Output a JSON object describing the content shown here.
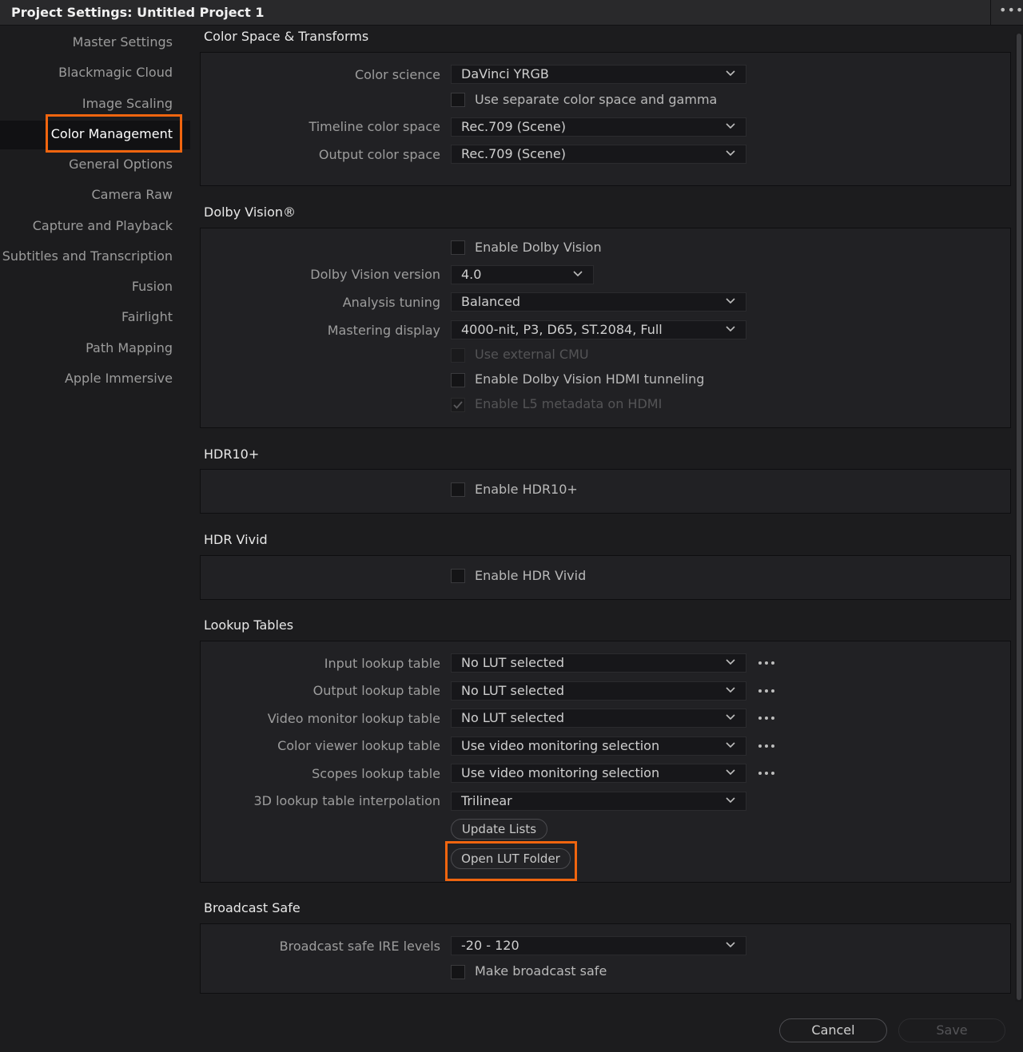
{
  "window": {
    "title": "Project Settings:  Untitled Project 1",
    "more_icon": "more-horizontal-icon"
  },
  "sidebar": {
    "items": [
      {
        "label": "Master Settings"
      },
      {
        "label": "Blackmagic Cloud"
      },
      {
        "label": "Image Scaling"
      },
      {
        "label": "Color Management",
        "active": true
      },
      {
        "label": "General Options"
      },
      {
        "label": "Camera Raw"
      },
      {
        "label": "Capture and Playback"
      },
      {
        "label": "Subtitles and Transcription"
      },
      {
        "label": "Fusion"
      },
      {
        "label": "Fairlight"
      },
      {
        "label": "Path Mapping"
      },
      {
        "label": "Apple Immersive"
      }
    ]
  },
  "color_space": {
    "title": "Color Space & Transforms",
    "color_science_label": "Color science",
    "color_science_value": "DaVinci YRGB",
    "separate_gamma_label": "Use separate color space and gamma",
    "timeline_label": "Timeline color space",
    "timeline_value": "Rec.709 (Scene)",
    "output_label": "Output color space",
    "output_value": "Rec.709 (Scene)"
  },
  "dolby": {
    "title": "Dolby Vision®",
    "enable_label": "Enable Dolby Vision",
    "version_label": "Dolby Vision version",
    "version_value": "4.0",
    "analysis_label": "Analysis tuning",
    "analysis_value": "Balanced",
    "mastering_label": "Mastering display",
    "mastering_value": "4000-nit, P3, D65, ST.2084, Full",
    "external_cmu_label": "Use external CMU",
    "hdmi_tunneling_label": "Enable Dolby Vision HDMI tunneling",
    "l5_label": "Enable L5 metadata on HDMI"
  },
  "hdr10": {
    "title": "HDR10+",
    "enable_label": "Enable HDR10+"
  },
  "hdr_vivid": {
    "title": "HDR Vivid",
    "enable_label": "Enable HDR Vivid"
  },
  "luts": {
    "title": "Lookup Tables",
    "input_label": "Input lookup table",
    "input_value": "No LUT selected",
    "output_label": "Output lookup table",
    "output_value": "No LUT selected",
    "video_monitor_label": "Video monitor lookup table",
    "video_monitor_value": "No LUT selected",
    "color_viewer_label": "Color viewer lookup table",
    "color_viewer_value": "Use video monitoring selection",
    "scopes_label": "Scopes lookup table",
    "scopes_value": "Use video monitoring selection",
    "interp_label": "3D lookup table interpolation",
    "interp_value": "Trilinear",
    "update_button": "Update Lists",
    "open_folder_button": "Open LUT Folder"
  },
  "broadcast": {
    "title": "Broadcast Safe",
    "ire_label": "Broadcast safe IRE levels",
    "ire_value": "-20 - 120",
    "make_safe_label": "Make broadcast safe"
  },
  "footer": {
    "cancel": "Cancel",
    "save": "Save"
  },
  "colors": {
    "highlight": "#f0650f",
    "background": "#1c1c1e",
    "panel": "#212124"
  }
}
